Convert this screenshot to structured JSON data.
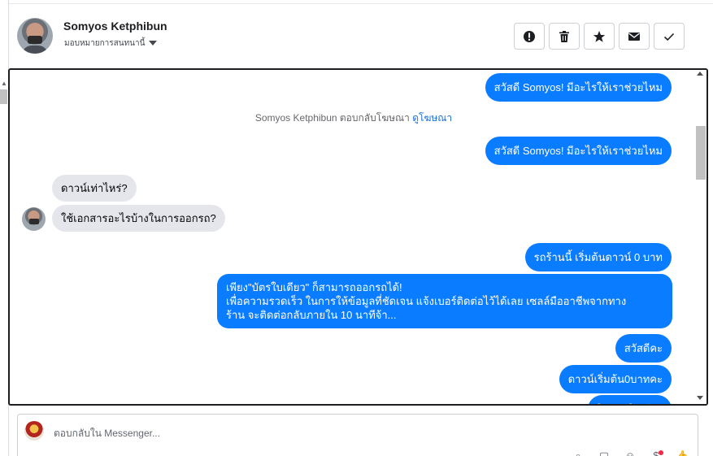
{
  "header": {
    "name": "Somyos Ketphibun",
    "assign_label": "มอบหมายการสนทนานี้",
    "actions": [
      {
        "icon": "alert-icon",
        "label": "!"
      },
      {
        "icon": "trash-icon",
        "label": ""
      },
      {
        "icon": "star-icon",
        "label": ""
      },
      {
        "icon": "mail-icon",
        "label": ""
      },
      {
        "icon": "check-icon",
        "label": ""
      }
    ]
  },
  "conversation": {
    "system_note": {
      "text": "Somyos Ketphibun ตอบกลับโฆษณา",
      "link": "ดูโฆษณา"
    },
    "messages": [
      {
        "side": "out",
        "text": "สวัสดี Somyos! มีอะไรให้เราช่วยไหม"
      },
      {
        "side": "out",
        "text": "สวัสดี Somyos! มีอะไรให้เราช่วยไหม"
      },
      {
        "side": "in",
        "text": "ดาวน์เท่าไหร่?"
      },
      {
        "side": "in",
        "text": "ใช้เอกสารอะไรบ้างในการออกรถ?"
      },
      {
        "side": "out",
        "text": "รถร้านนี้ เริ่มต้นดาวน์ 0 บาท"
      },
      {
        "side": "out",
        "lines": [
          "เพียง\"บัตรใบเดียว\" ก็สามารถออกรถได้!",
          "เพื่อความรวดเร็ว ในการให้ข้อมูลที่ชัดเจน แจ้งเบอร์ติดต่อไว้ได้เลย เซลล์มืออาชีพจากทาง",
          "ร้าน จะติดต่อกลับภายใน 10 นาทีจ้า..."
        ]
      },
      {
        "side": "out",
        "text": "สวัสดีคะ"
      },
      {
        "side": "out",
        "text": "ดาวน์เริ่มต้น0บาทคะ"
      },
      {
        "side": "out",
        "text": "ใช้บัตรใบเดียว"
      }
    ]
  },
  "composer": {
    "placeholder": "ตอบกลับใน Messenger...",
    "tools": [
      "attach-icon",
      "sticker-icon",
      "emoji-icon",
      "money-icon",
      "thumbs-up-icon"
    ]
  },
  "colors": {
    "accent": "#0a7cff",
    "incoming": "#e4e6eb",
    "link": "#1a6ed8"
  }
}
